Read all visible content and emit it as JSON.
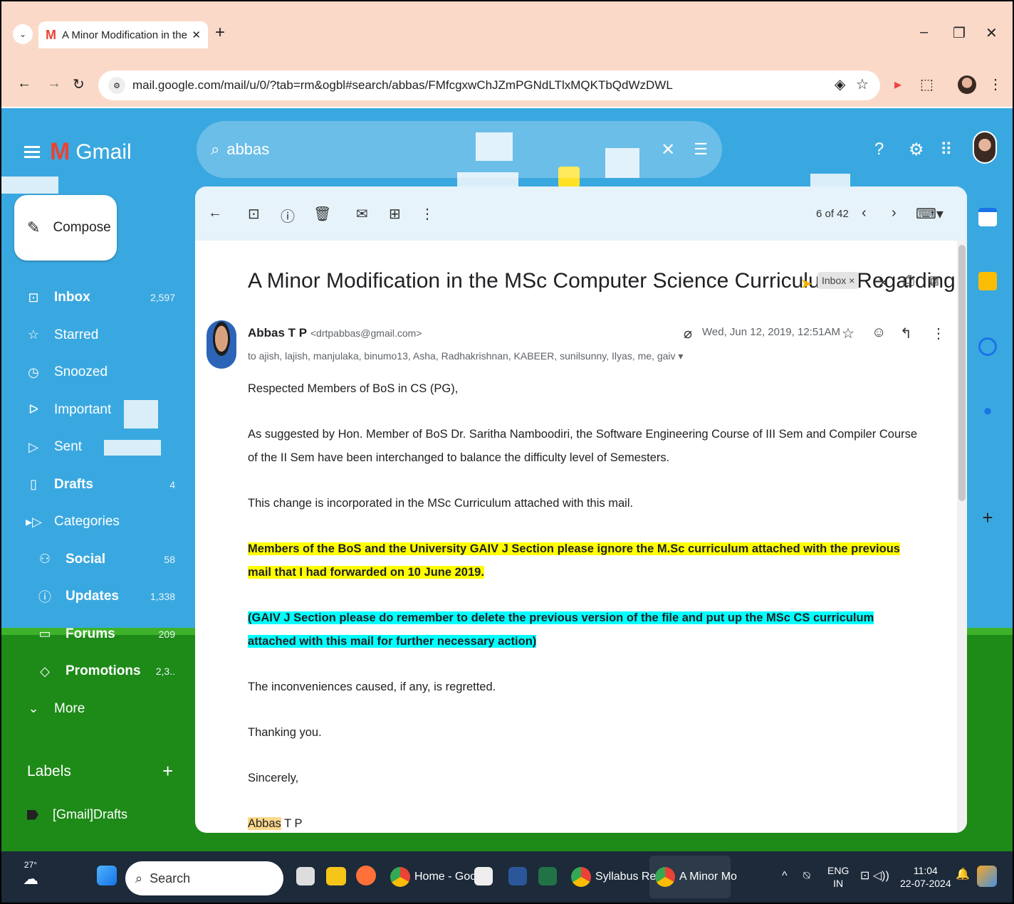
{
  "browser": {
    "tab_title": "A Minor Modification in the MS",
    "url": "mail.google.com/mail/u/0/?tab=rm&ogbl#search/abbas/FMfcgxwChJZmPGNdLTlxMQKTbQdWzDWL"
  },
  "gmail": {
    "brand": "Gmail",
    "search_value": "abbas",
    "compose_label": "Compose",
    "nav": [
      {
        "icon": "inbox-icon",
        "label": "Inbox",
        "count": "2,597",
        "bold": true
      },
      {
        "icon": "star-icon",
        "label": "Starred",
        "count": "",
        "bold": false
      },
      {
        "icon": "clock-icon",
        "label": "Snoozed",
        "count": "",
        "bold": false
      },
      {
        "icon": "important-icon",
        "label": "Important",
        "count": "",
        "bold": false
      },
      {
        "icon": "send-icon",
        "label": "Sent",
        "count": "",
        "bold": false
      },
      {
        "icon": "draft-icon",
        "label": "Drafts",
        "count": "4",
        "bold": true
      },
      {
        "icon": "label-icon",
        "label": "Categories",
        "count": "",
        "bold": false
      },
      {
        "icon": "people-icon",
        "label": "Social",
        "count": "58",
        "bold": true
      },
      {
        "icon": "info-icon",
        "label": "Updates",
        "count": "1,338",
        "bold": true
      },
      {
        "icon": "forum-icon",
        "label": "Forums",
        "count": "209",
        "bold": true
      },
      {
        "icon": "tag-icon",
        "label": "Promotions",
        "count": "2,3..",
        "bold": true
      },
      {
        "icon": "chevron-down-icon",
        "label": "More",
        "count": "",
        "bold": false
      }
    ],
    "labels_header": "Labels",
    "label_item": "[Gmail]Drafts"
  },
  "message": {
    "pager": "6 of 42",
    "subject": "A Minor Modification in the MSc Computer Science Curriculum - Regarding",
    "inbox_chip": "Inbox ×",
    "sender_name": "Abbas T P",
    "sender_email": "<drtpabbas@gmail.com>",
    "to_line": "to ajish, lajish, manjulaka, binumo13, Asha, Radhakrishnan, KABEER, sunilsunny, Ilyas, me, gaiv ▾",
    "date": "Wed, Jun 12, 2019, 12:51AM",
    "body": {
      "greeting": "Respected Members of BoS in CS (PG),",
      "p1": "As suggested by Hon. Member of BoS Dr. Saritha Namboodiri, the Software Engineering Course of III Sem and Compiler Course of the II Sem have been interchanged to balance the difficulty level of Semesters.",
      "p2": "This change is incorporated in the MSc Curriculum attached with this mail.",
      "p3": "Members of the BoS and the University GAIV J Section please ignore the M.Sc curriculum attached with the previous mail that I had forwarded on 10 June 2019.",
      "p4": "(GAIV J Section please do remember to delete the previous version of the file and put up the MSc CS curriculum attached with this mail for further necessary action)",
      "p5": "The inconveniences caused, if any, is regretted.",
      "p6": "Thanking you.",
      "p7": "Sincerely,",
      "sig_first": "Abbas",
      "sig_rest": " T P"
    }
  },
  "taskbar": {
    "weather_temp": "27°",
    "search_label": "Search",
    "apps": [
      "Home - Goo",
      "Syllabus Rev",
      "A Minor Mo"
    ],
    "lang_top": "ENG",
    "lang_bottom": "IN",
    "time": "11:04",
    "date": "22-07-2024"
  },
  "colors": {
    "gmail_bg": "#3aa8e0",
    "highlight_yellow": "#ffff00",
    "highlight_cyan": "#00ffff",
    "tab_bar": "#fbd9c8"
  }
}
